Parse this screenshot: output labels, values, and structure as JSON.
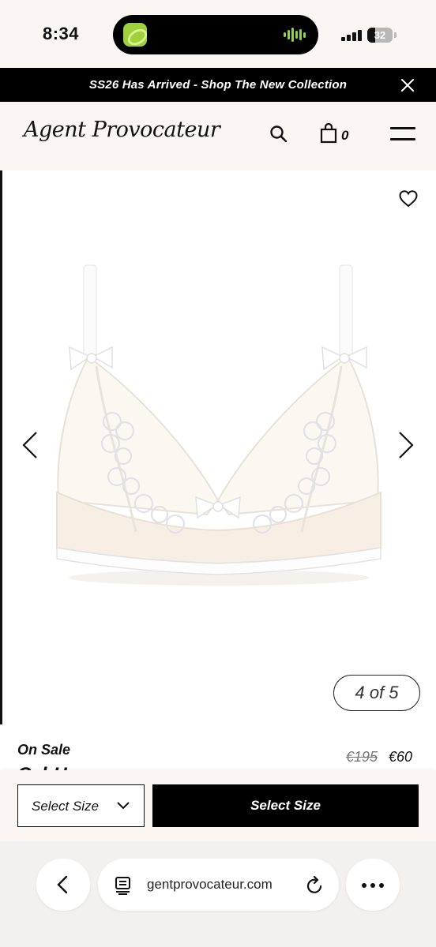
{
  "status_bar": {
    "time": "8:34",
    "battery_level": "32"
  },
  "banner": {
    "text": "SS26 Has Arrived - Shop The New Collection"
  },
  "header": {
    "logo": "Agent Provocateur",
    "bag_count": "0"
  },
  "gallery": {
    "image_counter": "4 of 5"
  },
  "product": {
    "badge": "On Sale",
    "name": "Cal-Ha",
    "original_price": "€195",
    "sale_price": "€60"
  },
  "actions": {
    "size_dropdown_value": "Select Size",
    "select_size_button": "Select Size"
  },
  "browser": {
    "url": "gentprovocateur.com"
  },
  "icons": {
    "status": [
      "signal-icon",
      "battery-icon"
    ],
    "banner": [
      "close-icon"
    ],
    "header": [
      "search-icon",
      "bag-icon",
      "menu-icon"
    ],
    "gallery": [
      "heart-icon",
      "chevron-left-icon",
      "chevron-right-icon"
    ],
    "browser": [
      "back-icon",
      "tabs-icon",
      "reload-icon",
      "more-icon"
    ]
  },
  "colors": {
    "background": "#faf6f3",
    "banner": "#000000",
    "primary_button": "#000000",
    "old_price": "#777777"
  }
}
